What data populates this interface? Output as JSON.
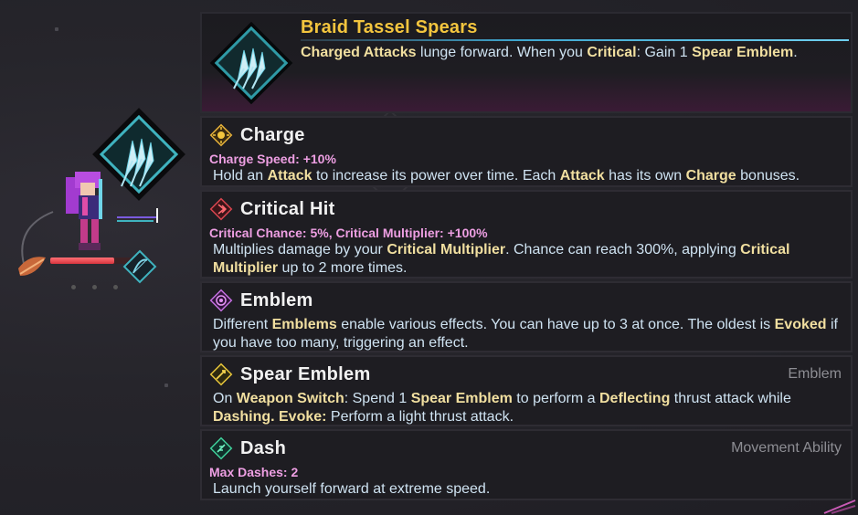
{
  "item": {
    "title": "Braid Tassel Spears",
    "description_parts": [
      "Charged Attacks",
      " lunge forward. When you ",
      "Critical",
      ": Gain 1 ",
      "Spear Emblem",
      "."
    ]
  },
  "sections": [
    {
      "name": "Charge",
      "icon": "charge-icon",
      "tag": "",
      "stat": "Charge Speed: +10%",
      "parts": [
        "Hold an ",
        "Attack",
        " to increase its power over time. Each ",
        "Attack",
        " has its own ",
        "Charge",
        " bonuses."
      ]
    },
    {
      "name": "Critical Hit",
      "icon": "critical-hit-icon",
      "tag": "",
      "stat": "Critical Chance: 5%, Critical Multiplier: +100%",
      "parts": [
        "Multiplies damage by your ",
        "Critical Multiplier",
        ". Chance can reach 300%, applying ",
        "Critical Multiplier",
        " up to 2 more times."
      ]
    },
    {
      "name": "Emblem",
      "icon": "emblem-icon",
      "tag": "",
      "stat": "",
      "parts": [
        "Different ",
        "Emblems",
        " enable various effects. You can have up to 3 at once. The oldest is ",
        "Evoked",
        " if you have too many, triggering an effect."
      ]
    },
    {
      "name": "Spear Emblem",
      "icon": "spear-emblem-icon",
      "tag": "Emblem",
      "stat": "",
      "parts": [
        "On ",
        "Weapon Switch",
        ": Spend 1 ",
        "Spear Emblem",
        " to perform a ",
        "Deflecting",
        " thrust attack while ",
        "Dashing. Evoke:",
        " Perform a light thrust attack."
      ]
    },
    {
      "name": "Dash",
      "icon": "dash-icon",
      "tag": "Movement Ability",
      "stat": "Max Dashes: 2",
      "parts": [
        "Launch yourself forward at extreme speed."
      ]
    }
  ],
  "player": {
    "health_fraction": 0.78
  },
  "colors": {
    "title": "#f3c53e",
    "keyword": "#f1dfa0",
    "stat": "#ee9fe3",
    "text": "#cfe3f2",
    "accent": "#3fa7d0"
  }
}
